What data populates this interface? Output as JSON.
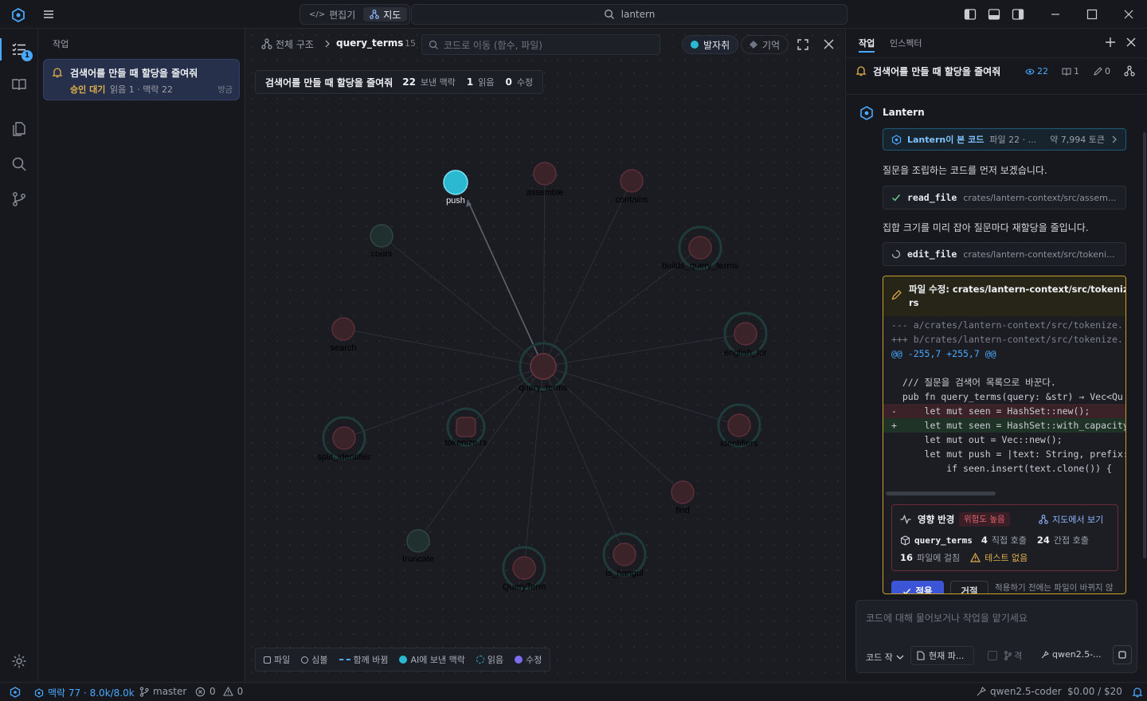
{
  "titlebar": {
    "editor_label": "편집기",
    "map_label": "지도",
    "search_text": "lantern"
  },
  "activity": {
    "tasks_badge": "1"
  },
  "sidebar": {
    "title": "작업",
    "task": {
      "title": "검색어를 만들 때 할당을 줄여줘",
      "status": "승인 대기",
      "meta": "읽음 1 · 맥락 22",
      "time": "방금"
    }
  },
  "map": {
    "breadcrumb_root": "전체 구조",
    "breadcrumb_current": "query_terms",
    "breadcrumb_count": "15",
    "search_placeholder": "코드로 이동 (함수, 파일)",
    "trail_label": "발자취",
    "memory_label": "기억",
    "summary": {
      "title": "검색어를 만들 때 할당을 줄여줘",
      "context_count": "22",
      "context_label": "보낸 맥락",
      "read_count": "1",
      "read_label": "읽음",
      "edit_count": "0",
      "edit_label": "수정"
    },
    "nodes": [
      {
        "id": "query_terms",
        "label": "query_terms"
      },
      {
        "id": "push",
        "label": "push"
      },
      {
        "id": "assemble",
        "label": "assemble"
      },
      {
        "id": "contains",
        "label": "contains"
      },
      {
        "id": "count",
        "label": "count"
      },
      {
        "id": "builds_query_terms",
        "label": "builds_query_terms"
      },
      {
        "id": "search",
        "label": "search"
      },
      {
        "id": "english_for",
        "label": "english_for"
      },
      {
        "id": "split_identifier",
        "label": "split_identifier"
      },
      {
        "id": "tokenize_rs",
        "label": "tokenize.rs"
      },
      {
        "id": "identifiers",
        "label": "identifiers"
      },
      {
        "id": "find",
        "label": "find"
      },
      {
        "id": "truncate",
        "label": "truncate"
      },
      {
        "id": "QueryTerm",
        "label": "QueryTerm"
      },
      {
        "id": "is_hangul",
        "label": "is_hangul"
      }
    ],
    "legend": {
      "file": "파일",
      "symbol": "심볼",
      "changed_together": "함께 바뀜",
      "sent_to_ai": "AI에 보낸 맥락",
      "read": "읽음",
      "edited": "수정"
    }
  },
  "assistant": {
    "tab_task": "작업",
    "tab_inspector": "인스펙터",
    "task_title": "검색어를 만들 때 할당을 줄여줘",
    "stat_context": "22",
    "stat_read": "1",
    "stat_edit": "0",
    "agent_name": "Lantern",
    "seen_code": {
      "label": "Lantern이 본 코드",
      "files": "파일 22 · ...",
      "tokens": "약 7,994 토큰"
    },
    "msg1": "질문을 조립하는 코드를 먼저 보겠습니다.",
    "tool1": {
      "name": "read_file",
      "path": "crates/lantern-context/src/assem..."
    },
    "msg2": "집합 크기를 미리 잡아 질문마다 재할당을 줄입니다.",
    "tool2": {
      "name": "edit_file",
      "path": "crates/lantern-context/src/tokeni..."
    },
    "diff": {
      "title_line1": "파일 수정: crates/lantern-context/src/tokenize.",
      "title_line2": "rs",
      "lines": [
        "--- a/crates/lantern-context/src/tokenize.",
        "+++ b/crates/lantern-context/src/tokenize.",
        "@@ -255,7 +255,7 @@",
        "",
        "  /// 질문을 검색어 목록으로 바꾼다.",
        "  pub fn query_terms(query: &str) → Vec<Qu",
        "-     let mut seen = HashSet::new();",
        "+     let mut seen = HashSet::with_capacity",
        "      let mut out = Vec::new();",
        "      let mut push = |text: String, prefix:",
        "          if seen.insert(text.clone()) {"
      ]
    },
    "impact": {
      "title": "영향 반경",
      "risk": "위험도 높음",
      "view_on_map": "지도에서 보기",
      "symbol": "query_terms",
      "direct_count": "4",
      "direct_label": "직접 호출",
      "indirect_count": "24",
      "indirect_label": "간접 호출",
      "files_count": "16",
      "files_label": "파일에 걸침",
      "no_tests": "테스트 없음"
    },
    "apply_label": "적용",
    "reject_label": "거절",
    "apply_note": "적용하기 전에는 파일이 바뀌지 않",
    "composer": {
      "placeholder": "코드에 대해 물어보거나 작업을 맡기세요",
      "mode": "코드 작",
      "current_file": "현재 파...",
      "git_label": "격",
      "model": "qwen2.5-..."
    }
  },
  "statusbar": {
    "context": "맥락 77 · 8.0k/8.0k",
    "branch": "master",
    "errors": "0",
    "warnings": "0",
    "model": "qwen2.5-coder",
    "cost": "$0.00 / $20"
  },
  "colors": {
    "accent": "#4aa8ff",
    "node_active": "#2bb8d1",
    "node_red": "#5a2e33",
    "node_green": "#203a36",
    "warning": "#e0b04a",
    "danger": "#e0606e",
    "purple": "#7c6cf0"
  }
}
